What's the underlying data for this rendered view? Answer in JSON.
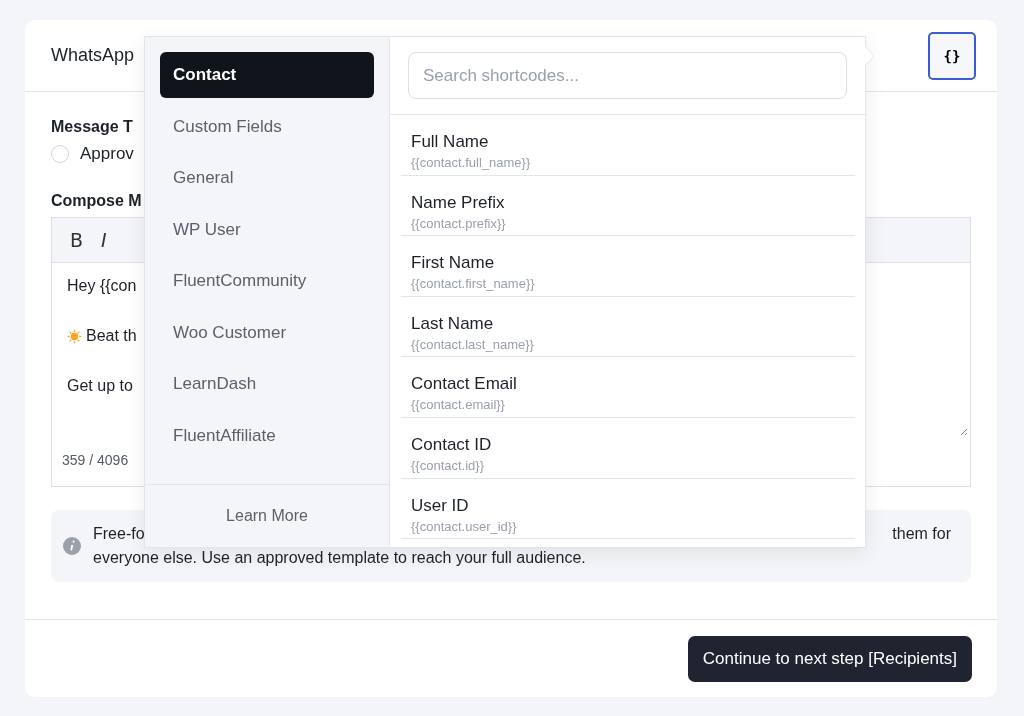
{
  "header": {
    "title": "WhatsApp",
    "shortcode_button": "{}"
  },
  "message_type": {
    "label": "Message T",
    "options": [
      {
        "label": "Approv",
        "selected": false
      }
    ]
  },
  "compose": {
    "label": "Compose M",
    "toolbar": [
      "B",
      "I"
    ],
    "lines": [
      {
        "kind": "text",
        "text": "Hey {{con"
      },
      {
        "kind": "emoji",
        "text": "Beat th"
      },
      {
        "kind": "text",
        "text": "Get up to"
      }
    ],
    "counter": "359 / 4096"
  },
  "info": {
    "line_start": "Free-fo",
    "line_end": "them for",
    "text": "everyone else. Use an approved template to reach your full audience."
  },
  "popover": {
    "groups": [
      {
        "label": "Contact",
        "selected": true
      },
      {
        "label": "Custom Fields",
        "selected": false
      },
      {
        "label": "General",
        "selected": false
      },
      {
        "label": "WP User",
        "selected": false
      },
      {
        "label": "FluentCommunity",
        "selected": false
      },
      {
        "label": "Woo Customer",
        "selected": false
      },
      {
        "label": "LearnDash",
        "selected": false
      },
      {
        "label": "FluentAffiliate",
        "selected": false
      }
    ],
    "learn_more": "Learn More",
    "search": {
      "placeholder": "Search shortcodes..."
    },
    "items": [
      {
        "label": "Full Name",
        "code": "{{contact.full_name}}"
      },
      {
        "label": "Name Prefix",
        "code": "{{contact.prefix}}"
      },
      {
        "label": "First Name",
        "code": "{{contact.first_name}}"
      },
      {
        "label": "Last Name",
        "code": "{{contact.last_name}}"
      },
      {
        "label": "Contact Email",
        "code": "{{contact.email}}"
      },
      {
        "label": "Contact ID",
        "code": "{{contact.id}}"
      },
      {
        "label": "User ID",
        "code": "{{contact.user_id}}"
      }
    ]
  },
  "footer": {
    "continue_button": "Continue to next step [Recipients]"
  }
}
